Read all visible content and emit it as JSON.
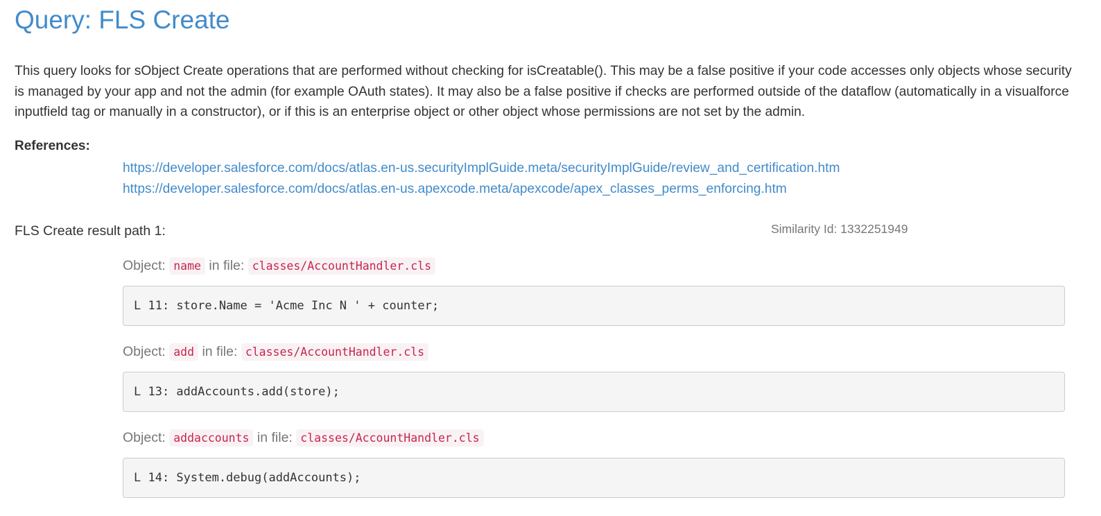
{
  "query": {
    "title": "Query: FLS Create",
    "description": "This query looks for sObject Create operations that are performed without checking for isCreatable(). This may be a false positive if your code accesses only objects whose security is managed by your app and not the admin (for example OAuth states). It may also be a false positive if checks are performed outside of the dataflow (automatically in a visualforce inputfield tag or manually in a constructor), or if this is an enterprise object or other object whose permissions are not set by the admin."
  },
  "references": {
    "label": "References:",
    "links": [
      "https://developer.salesforce.com/docs/atlas.en-us.securityImplGuide.meta/securityImplGuide/review_and_certification.htm",
      "https://developer.salesforce.com/docs/atlas.en-us.apexcode.meta/apexcode/apex_classes_perms_enforcing.htm"
    ]
  },
  "result_path": {
    "heading": "FLS Create result path 1:",
    "similarity": "Similarity Id: 1332251949",
    "steps": [
      {
        "object_label": "Object:",
        "object": "name",
        "file_label": "in file:",
        "file": "classes/AccountHandler.cls",
        "code": "L 11: store.Name = 'Acme Inc N ' + counter;"
      },
      {
        "object_label": "Object:",
        "object": "add",
        "file_label": "in file:",
        "file": "classes/AccountHandler.cls",
        "code": "L 13: addAccounts.add(store);"
      },
      {
        "object_label": "Object:",
        "object": "addaccounts",
        "file_label": "in file:",
        "file": "classes/AccountHandler.cls",
        "code": "L 14: System.debug(addAccounts);"
      }
    ]
  },
  "colors": {
    "link": "#428bca",
    "code_text": "#c7254e",
    "code_bg": "#f9f2f4",
    "muted": "#777777"
  }
}
